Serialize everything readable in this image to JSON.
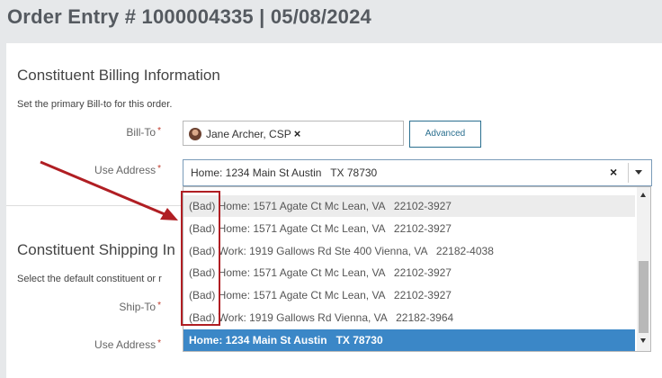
{
  "page": {
    "title": "Order Entry # 1000004335 | 05/08/2024"
  },
  "billing": {
    "title": "Constituent Billing Information",
    "description": "Set the primary Bill-to for this order.",
    "bill_to_label": "Bill-To",
    "bill_to_value": "Jane Archer, CSP",
    "remove_symbol": "×",
    "advanced_label": "Advanced",
    "use_address_label": "Use Address",
    "use_address_value": "Home: 1234 Main St Austin   TX 78730",
    "clear_symbol": "×",
    "required_mark": "*"
  },
  "shipping": {
    "title": "Constituent Shipping In",
    "description": "Select the default constituent or r",
    "ship_to_label": "Ship-To",
    "use_address_label": "Use Address",
    "required_mark": "*"
  },
  "dropdown": {
    "options": [
      "(Bad) Home: 1571 Agate Ct Mc Lean, VA   22102-3927",
      "(Bad) Home: 1571 Agate Ct Mc Lean, VA   22102-3927",
      "(Bad) Work: 1919 Gallows Rd Ste 400 Vienna, VA   22182-4038",
      "(Bad) Home: 1571 Agate Ct Mc Lean, VA   22102-3927",
      "(Bad) Home: 1571 Agate Ct Mc Lean, VA   22102-3927",
      "(Bad) Work: 1919 Gallows Rd Vienna, VA   22182-3964",
      "Home: 1234 Main St Austin   TX 78730"
    ],
    "hovered_index": 0,
    "selected_index": 6
  },
  "colors": {
    "accent": "#3b87c7",
    "annotation": "#b01e23",
    "button_border": "#2a6f8f"
  },
  "icons": {
    "avatar": "user-avatar-icon",
    "chip_remove": "close-icon",
    "clear": "clear-icon",
    "caret": "chevron-down-icon",
    "scroll_up": "scroll-up-icon",
    "scroll_down": "scroll-down-icon",
    "annotation_arrow": "arrow-icon"
  }
}
